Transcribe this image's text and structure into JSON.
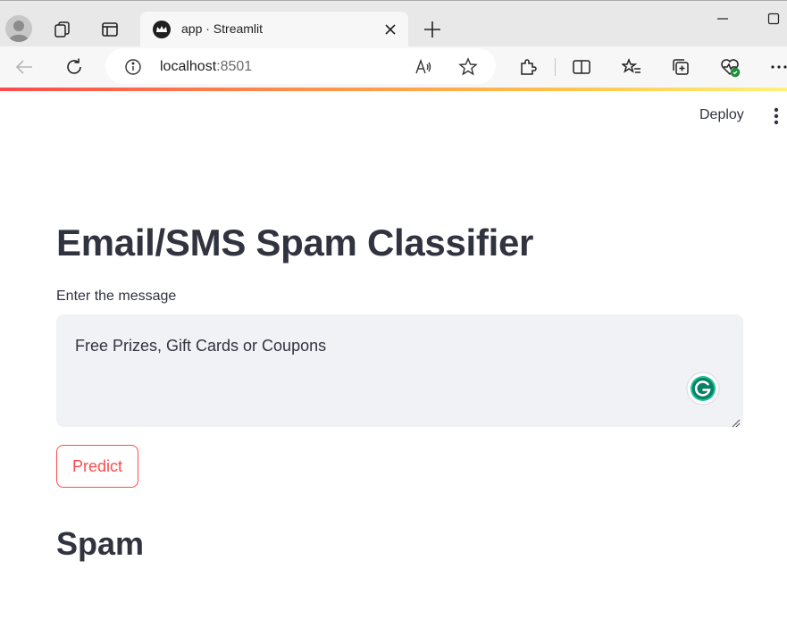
{
  "browser": {
    "tab_title": "app · Streamlit",
    "url_host": "localhost",
    "url_port": ":8501",
    "icons": {
      "profile": "profile-avatar-icon",
      "workspaces": "workspaces-icon",
      "tab_actions": "vertical-tabs-icon",
      "favicon": "streamlit-crown-icon",
      "close": "close-icon",
      "new_tab": "plus-icon",
      "minimize": "minimize-icon",
      "maximize": "maximize-icon",
      "back": "arrow-left-icon",
      "refresh": "refresh-icon",
      "info": "info-icon",
      "read_aloud": "read-aloud-icon",
      "favorite": "star-icon",
      "extensions": "puzzle-icon",
      "split_screen": "split-screen-icon",
      "favorites": "favorites-list-icon",
      "collections": "collections-icon",
      "health": "browser-essentials-icon",
      "more": "more-horizontal-icon"
    }
  },
  "app": {
    "deploy_label": "Deploy",
    "title": "Email/SMS Spam Classifier",
    "input_label": "Enter the message",
    "input_value": "Free Prizes, Gift Cards or Coupons",
    "predict_label": "Predict",
    "result": "Spam",
    "colors": {
      "primary": "#ff4b4b",
      "text": "#31333f",
      "input_bg": "#f0f2f6",
      "grammarly": "#15c39a"
    }
  }
}
